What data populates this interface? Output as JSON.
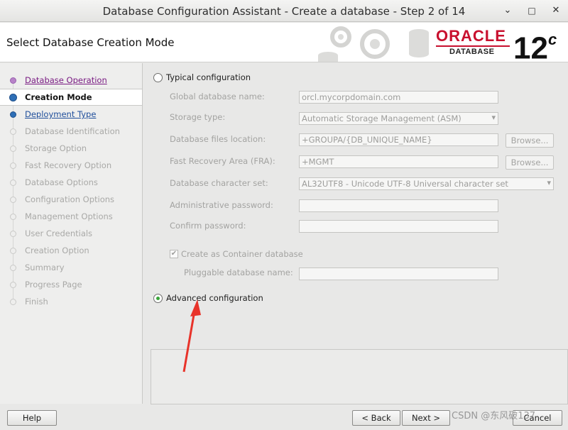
{
  "window": {
    "title": "Database Configuration Assistant - Create a database - Step 2 of 14",
    "minimize": "⌄",
    "maximize": "▫",
    "close": "✕"
  },
  "header": {
    "title": "Select Database Creation Mode",
    "logo_text": "ORACLE",
    "logo_sub": "DATABASE",
    "version": "12",
    "version_sup": "c"
  },
  "steps": [
    {
      "label": "Database Operation",
      "state": "done"
    },
    {
      "label": "Creation Mode",
      "state": "current"
    },
    {
      "label": "Deployment Type",
      "state": "next"
    },
    {
      "label": "Database Identification",
      "state": "disabled"
    },
    {
      "label": "Storage Option",
      "state": "disabled"
    },
    {
      "label": "Fast Recovery Option",
      "state": "disabled"
    },
    {
      "label": "Database Options",
      "state": "disabled"
    },
    {
      "label": "Configuration Options",
      "state": "disabled"
    },
    {
      "label": "Management Options",
      "state": "disabled"
    },
    {
      "label": "User Credentials",
      "state": "disabled"
    },
    {
      "label": "Creation Option",
      "state": "disabled"
    },
    {
      "label": "Summary",
      "state": "disabled"
    },
    {
      "label": "Progress Page",
      "state": "disabled"
    },
    {
      "label": "Finish",
      "state": "disabled"
    }
  ],
  "typical": {
    "label": "Typical configuration",
    "selected": false,
    "global_db_name": {
      "label": "Global database name:",
      "value": "orcl.mycorpdomain.com"
    },
    "storage_type": {
      "label": "Storage type:",
      "value": "Automatic Storage Management (ASM)"
    },
    "db_files_location": {
      "label": "Database files location:",
      "value": "+GROUPA/{DB_UNIQUE_NAME}"
    },
    "fra": {
      "label": "Fast Recovery Area (FRA):",
      "value": "+MGMT"
    },
    "charset": {
      "label": "Database character set:",
      "value": "AL32UTF8 - Unicode UTF-8 Universal character set"
    },
    "admin_password": {
      "label": "Administrative password:",
      "value": ""
    },
    "confirm_password": {
      "label": "Confirm password:",
      "value": ""
    },
    "container_db": {
      "label": "Create as Container database",
      "checked": true
    },
    "pluggable_db_name": {
      "label": "Pluggable database name:",
      "value": ""
    },
    "browse_label": "Browse..."
  },
  "advanced": {
    "label": "Advanced configuration",
    "selected": true
  },
  "buttons": {
    "help": "Help",
    "back": "< Back",
    "next": "Next >",
    "cancel": "Cancel"
  },
  "watermark": "CSDN @东风破137",
  "colors": {
    "oracle_red": "#c8102e",
    "annotation_arrow": "#e8332a",
    "radio_selected": "#3aa53a"
  }
}
